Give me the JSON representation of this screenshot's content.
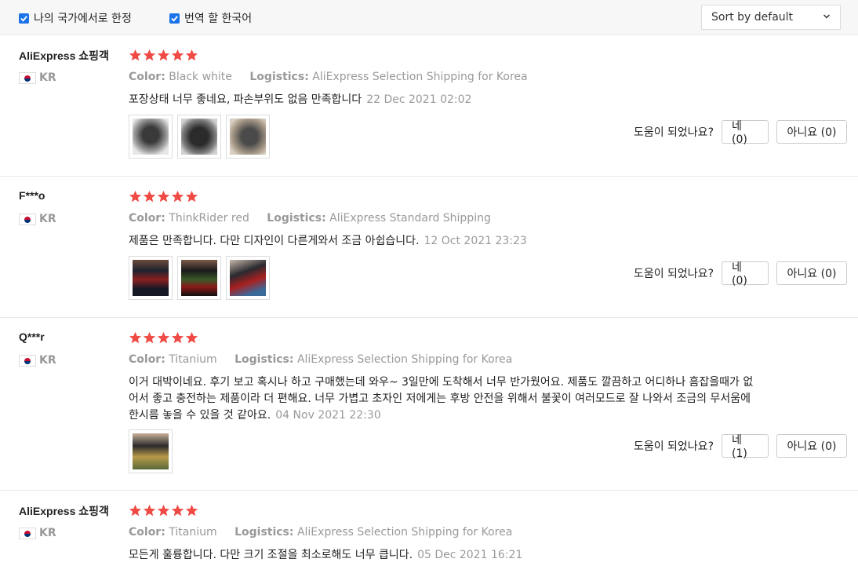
{
  "filters": {
    "my_country_label": "나의 국가에서로 한정",
    "translate_label": "번역 할 한국어"
  },
  "sort": {
    "selected": "Sort by default"
  },
  "labels": {
    "color": "Color:",
    "logistics": "Logistics:",
    "helpful": "도움이 되었나요?"
  },
  "reviews": [
    {
      "user": "AliExpress 쇼핑객",
      "country": "KR",
      "stars": 5,
      "color": "Black white",
      "logistics": "AliExpress Selection Shipping for Korea",
      "text": "포장상태 너무 좋네요, 파손부위도 없음 만족합니다",
      "date": "22 Dec 2021 02:02",
      "yes": "네 (0)",
      "no": "아니요 (0)"
    },
    {
      "user": "F***o",
      "country": "KR",
      "stars": 5,
      "color": "ThinkRider red",
      "logistics": "AliExpress Standard Shipping",
      "text": "제품은 만족합니다. 다만 디자인이 다른게와서 조금 아쉽습니다.",
      "date": "12 Oct 2021 23:23",
      "yes": "네 (0)",
      "no": "아니요 (0)"
    },
    {
      "user": "Q***r",
      "country": "KR",
      "stars": 5,
      "color": "Titanium",
      "logistics": "AliExpress Selection Shipping for Korea",
      "text": "이거 대박이네요. 후기 보고 혹시나 하고 구매했는데 와우~ 3일만에 도착해서 너무 반가웠어요. 제품도 깔끔하고 어디하나 흠잡을때가 없어서 좋고 충전하는 제품이라 더 편해요. 너무 가볍고 초자인 저에게는 후방 안전을 위해서 불꽃이 여러모드로 잘 나와서 조금의 무서움에 한시름 놓을 수 있을 것 같아요.",
      "date": "04 Nov 2021 22:30",
      "yes": "네 (1)",
      "no": "아니요 (0)"
    },
    {
      "user": "AliExpress 쇼핑객",
      "country": "KR",
      "stars": 5,
      "color": "Titanium",
      "logistics": "AliExpress Selection Shipping for Korea",
      "text": "모든게 훌륭합니다. 다만 크기 조절을 최소로해도 너무 큽니다.",
      "date": "05 Dec 2021 16:21"
    }
  ],
  "colors": {
    "star": "#f04a44",
    "checkbox": "#1a73e8"
  }
}
